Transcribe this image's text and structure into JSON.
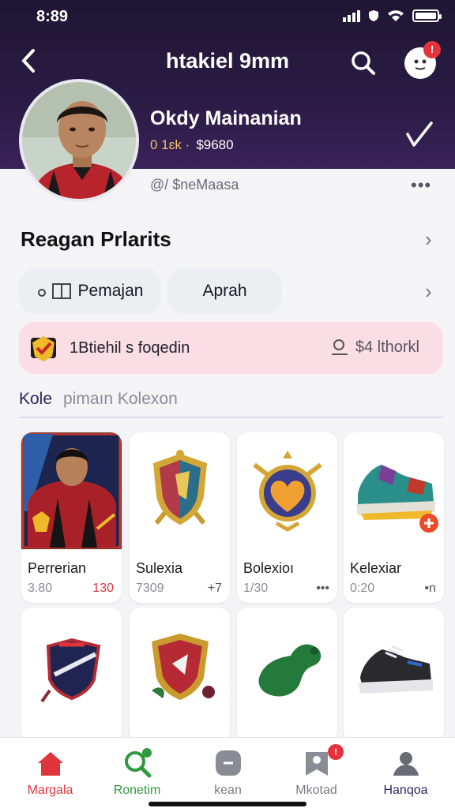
{
  "status_bar": {
    "time": "8:89"
  },
  "header": {
    "title": "htakiel 9mm",
    "notification_count": "!"
  },
  "profile": {
    "name": "Okdy Mainanian",
    "stats": "0 1ɛk ·",
    "coins": "$9680",
    "subline": "@/ $neMaasa",
    "more": "•••"
  },
  "section": {
    "title": "Reagan Prlarits"
  },
  "chips": [
    {
      "label": "Pemajan"
    },
    {
      "label": "Aprah"
    }
  ],
  "promo": {
    "label": "1Btiehil s foqedin",
    "reward": "$4 lthorkl"
  },
  "tabs": {
    "active": "Kole",
    "rest": "pimaın Kolexon"
  },
  "cards": [
    {
      "name": "Perrerian",
      "value": "3.80",
      "extra": "130",
      "icon": "player-card-icon"
    },
    {
      "name": "Sulexia",
      "value": "7309",
      "extra": "+7",
      "icon": "shield-crest-icon"
    },
    {
      "name": "Bolexioı",
      "value": "1/30",
      "extra": "•••",
      "icon": "heart-crest-icon"
    },
    {
      "name": "Kelexiar",
      "value": "0:20",
      "extra": "•n",
      "icon": "sneaker-icon"
    }
  ],
  "row2_icons": [
    "club-badge-icon",
    "red-crest-icon",
    "green-hook-icon",
    "black-sneaker-icon"
  ],
  "bottom_nav": [
    {
      "label": "Margala",
      "color": "#e0343c"
    },
    {
      "label": "Ronetim",
      "color": "#2f9a3d"
    },
    {
      "label": "kean",
      "color": "#7a7a84"
    },
    {
      "label": "Mkotad",
      "color": "#7a7a84",
      "badge": "!"
    },
    {
      "label": "Hanqoa",
      "color": "#2b2460"
    }
  ],
  "colors": {
    "header": "#231a3a",
    "accent_red": "#e5323b",
    "promo_bg": "#fbdde5",
    "active_green": "#2f9a3d"
  }
}
